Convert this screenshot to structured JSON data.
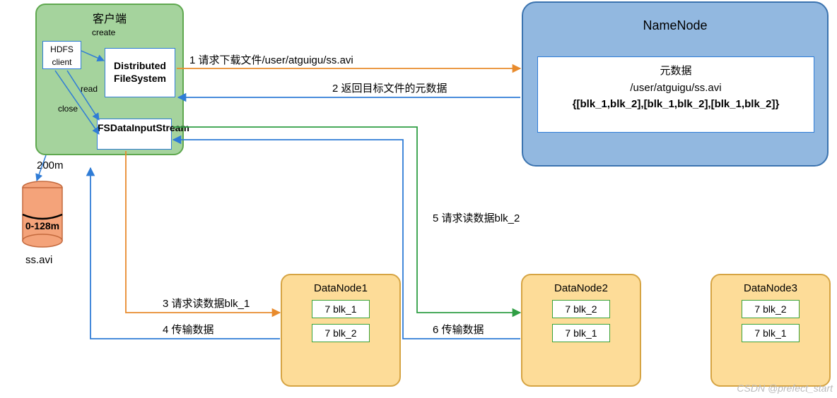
{
  "client": {
    "title": "客户端",
    "create": "create",
    "read": "read",
    "close": "close",
    "hdfs_box": "HDFS client",
    "dist_box": "Distributed FileSystem",
    "stream_box": "FSDataInputStream"
  },
  "cylinder": {
    "top_label": "200m",
    "body_label": "0-128m",
    "name": "ss.avi"
  },
  "namenode": {
    "title": "NameNode",
    "meta_title": "元数据",
    "meta_path": "/user/atguigu/ss.avi",
    "meta_blocks": "{[blk_1,blk_2],[blk_1,blk_2],[blk_1,blk_2]}"
  },
  "datanodes": [
    {
      "title": "DataNode1",
      "blocks": [
        "7 blk_1",
        "7 blk_2"
      ]
    },
    {
      "title": "DataNode2",
      "blocks": [
        "7 blk_2",
        "7 blk_1"
      ]
    },
    {
      "title": "DataNode3",
      "blocks": [
        "7 blk_2",
        "7 blk_1"
      ]
    }
  ],
  "labels": {
    "step1": "1 请求下载文件/user/atguigu/ss.avi",
    "step2": "2 返回目标文件的元数据",
    "step3": "3 请求读数据blk_1",
    "step4": "4 传输数据",
    "step5": "5 请求读数据blk_2",
    "step6": "6 传输数据"
  },
  "watermark": "CSDN @prefect_start"
}
